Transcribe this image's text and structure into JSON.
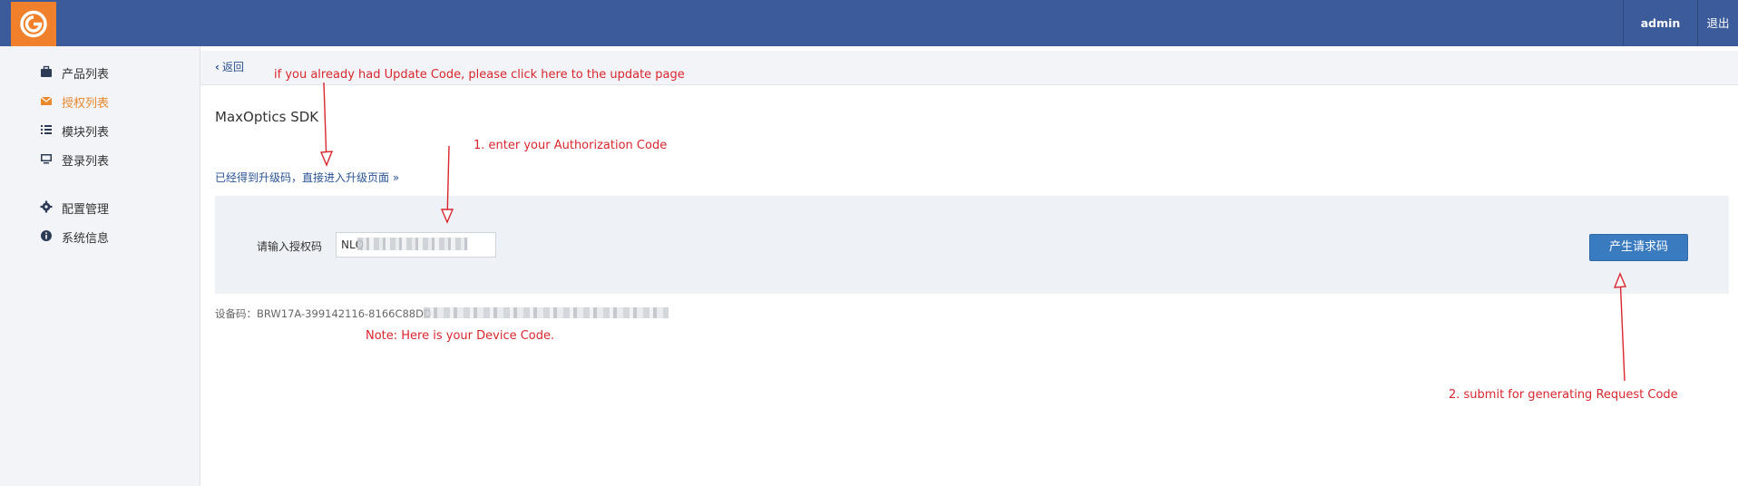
{
  "header": {
    "user": "admin",
    "logout": "退出",
    "brand_color": "#3c5b9a",
    "logo_color": "#f0802b"
  },
  "sidebar": {
    "items": [
      {
        "label": "产品列表",
        "icon": "briefcase-icon",
        "active": false
      },
      {
        "label": "授权列表",
        "icon": "envelope-icon",
        "active": true
      },
      {
        "label": "模块列表",
        "icon": "list-icon",
        "active": false
      },
      {
        "label": "登录列表",
        "icon": "monitor-icon",
        "active": false
      },
      {
        "label": "配置管理",
        "icon": "gear-icon",
        "active": false
      },
      {
        "label": "系统信息",
        "icon": "info-icon",
        "active": false
      }
    ],
    "active_color": "#e8882f"
  },
  "main": {
    "back_label": "返回",
    "title": "MaxOptics SDK",
    "upgrade_link": "已经得到升级码，直接进入升级页面 »",
    "auth_label": "请输入授权码",
    "auth_value": "NLQ",
    "submit_label": "产生请求码",
    "device_code_label": "设备码：",
    "device_code_value": "BRW17A-399142116-8166C88DD"
  },
  "annotations": {
    "update_hint": "if you already had Update Code, please click here to the update page",
    "step1": "1. enter your Authorization Code",
    "device_note": "Note: Here is your Device Code.",
    "step2": "2. submit for generating Request Code",
    "color": "#d9262e"
  }
}
